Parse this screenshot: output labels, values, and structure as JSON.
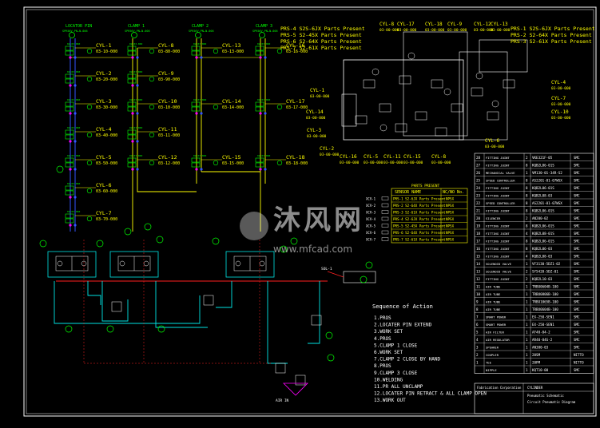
{
  "colors": {
    "background": "#000000",
    "frame": "#ffffff",
    "yellow": "#ffff00",
    "green": "#00ff00",
    "blue": "#3355ff",
    "cyan": "#00e5e5",
    "red": "#ff2020",
    "magenta": "#ff00ff"
  },
  "columns": [
    {
      "header": "LOCATOR PIN",
      "sub": "SPR56V-PN—N-006"
    },
    {
      "header": "CLAMP 1",
      "sub": "SPR56V-PN—N-006"
    },
    {
      "header": "CLAMP 2",
      "sub": "SPR56V-PN—N-006"
    },
    {
      "header": "CLAMP 3",
      "sub": "SPR56V-PN—N-006"
    }
  ],
  "left_cylinders": [
    {
      "name": "CYL-1",
      "code": "03-10-000"
    },
    {
      "name": "CYL-2",
      "code": "03-20-000"
    },
    {
      "name": "CYL-3",
      "code": "03-30-000"
    },
    {
      "name": "CYL-4",
      "code": "03-40-000"
    },
    {
      "name": "CYL-5",
      "code": "03-50-000"
    },
    {
      "name": "CYL-6",
      "code": "03-60-000"
    },
    {
      "name": "CYL-7",
      "code": "03-70-000"
    },
    {
      "name": "CYL-8",
      "code": "03-80-000"
    },
    {
      "name": "CYL-9",
      "code": "03-90-000"
    },
    {
      "name": "CYL-10",
      "code": "03-10-000"
    },
    {
      "name": "CYL-11",
      "code": "03-11-000"
    },
    {
      "name": "CYL-12",
      "code": "03-12-000"
    },
    {
      "name": "CYL-13",
      "code": "03-13-000"
    },
    {
      "name": "CYL-14",
      "code": "03-14-000"
    },
    {
      "name": "CYL-15",
      "code": "03-15-000"
    },
    {
      "name": "CYL-16",
      "code": "03-16-000"
    },
    {
      "name": "CYL-17",
      "code": "03-17-000"
    },
    {
      "name": "CYL-18",
      "code": "03-18-000"
    }
  ],
  "part_callouts": [
    "PRS-4  S2S-6JX Parts Present",
    "PRS-5  S2-45X Parts Present",
    "PRS-6  S2-64X Parts Present",
    "PRS-7  S2-61X Parts Present"
  ],
  "part_callouts_right": [
    "PRS-1  S2S-6JX Parts Present",
    "PRS-2  S2-64X Parts Present",
    "PRS-3  S2-61X Parts Present"
  ],
  "fixture_labels": [
    "CYL-17",
    "CYL-18",
    "CYL-9",
    "CYL-12",
    "CYL-13",
    "CYL-8",
    "CYL-1",
    "CYL-14",
    "CYL-3",
    "CYL-2",
    "CYL-16",
    "CYL-5",
    "CYL-11",
    "CYL-15",
    "CYL-8",
    "CYL-4",
    "CYL-7",
    "CYL-10",
    "CYL-6"
  ],
  "sensor_table": {
    "title": "PARTS PRESENT",
    "headers": [
      "SENSOR NAME",
      "NC/NO No."
    ],
    "rows": [
      [
        "PRS-1 S2-6JX Parts Present",
        "NPSX"
      ],
      [
        "PRS-2 S2-64X Parts Present",
        "NPSX"
      ],
      [
        "PRS-3 S2-61X Parts Present",
        "NPSX"
      ],
      [
        "PRS-4 S2-6JX Parts Present",
        "NPSX"
      ],
      [
        "PRS-5 S2-45X Parts Present",
        "NPSX"
      ],
      [
        "PRS-6 S2-64X Parts Present",
        "NPSX"
      ],
      [
        "PRS-7 S2-61X Parts Present",
        "NPSX"
      ]
    ],
    "side_labels": [
      "XCV-1",
      "XCV-2",
      "XCV-3",
      "XCV-4",
      "XCV-5",
      "XCV-6",
      "XCV-7"
    ]
  },
  "sequence": {
    "title": "Sequence of Action",
    "steps": [
      "1.PROS",
      "2.LOCATER PIN EXTEND",
      "3.WORK SET",
      "4.PROS",
      "5.CLAMP 1 CLOSE",
      "6.WORK SET",
      "7.CLAMP 2 CLOSE BY HAND",
      "8.PROS",
      "9.CLAMP 3 CLOSE",
      "10.WELDING",
      "11.PR ALL UNCLAMP",
      "12.LOCATER PIN RETRACT & ALL CLAMP OPEN",
      "13.WORK OUT"
    ]
  },
  "bom": [
    [
      "28",
      "FITTING JOINT",
      "2",
      "VKE321F-05",
      "SMC"
    ],
    [
      "27",
      "FITTING JOINT",
      "8",
      "KQB2L06-01S",
      "SMC"
    ],
    [
      "26",
      "MECHANICAL VALVE",
      "1",
      "VM130-01-34R-S2",
      "SMC"
    ],
    [
      "25",
      "SPEED CONTROLLER",
      "8",
      "AS2201-01-07WSX",
      "SMC"
    ],
    [
      "24",
      "FITTING JOINT",
      "8",
      "KQB2L06-01S",
      "SMC"
    ],
    [
      "23",
      "FITTING JOINT",
      "8",
      "KQB2L08-03",
      "SMC"
    ],
    [
      "22",
      "SPEED CONTROLLER",
      "8",
      "AS2201-01-07WSX",
      "SMC"
    ],
    [
      "21",
      "FITTING JOINT",
      "8",
      "KQB2L06-01S",
      "SMC"
    ],
    [
      "20",
      "SILENCER",
      "2",
      "AN200-02",
      "SMC"
    ],
    [
      "19",
      "FITTING JOINT",
      "8",
      "KQB2L06-01S",
      "SMC"
    ],
    [
      "18",
      "FITTING JOINT",
      "4",
      "KQB2L08-01S",
      "SMC"
    ],
    [
      "17",
      "FITTING JOINT",
      "8",
      "KQB2L06-01S",
      "SMC"
    ],
    [
      "16",
      "FITTING JOINT",
      "8",
      "KQB2L06-03",
      "SMC"
    ],
    [
      "15",
      "FITTING JOINT",
      "4",
      "KQB2L08-03",
      "SMC"
    ],
    [
      "14",
      "SOLENOID VALVE",
      "1",
      "VF3130-5DZ1-02",
      "SMC"
    ],
    [
      "13",
      "SOLENOID VALVE",
      "2",
      "SY5420-5DZ-01",
      "SMC"
    ],
    [
      "12",
      "FITTING JOINT",
      "2",
      "KQB2L10-03",
      "SMC"
    ],
    [
      "11",
      "AIR TUBE",
      "1",
      "TRBU0604B-100",
      "SMC"
    ],
    [
      "10",
      "AIR TUBE",
      "1",
      "TRBU0806B-100",
      "SMC"
    ],
    [
      "9",
      "AIR TUBE",
      "1",
      "TRBU1065B-100",
      "SMC"
    ],
    [
      "8",
      "AIR TUBE",
      "1",
      "TRBU0604B-100",
      "SMC"
    ],
    [
      "7",
      "SMART POWER",
      "1",
      "EX-250-SEN1",
      "SMC"
    ],
    [
      "6",
      "SMART POWER",
      "1",
      "EX-250-SEN1",
      "SMC"
    ],
    [
      "5",
      "AIR FILTER",
      "1",
      "AF40-04-2",
      "SMC"
    ],
    [
      "4",
      "AIR REGULATOR",
      "1",
      "AR40-04G-2",
      "SMC"
    ],
    [
      "3",
      "SPEAKER",
      "1",
      "AN300-03",
      "SMC"
    ],
    [
      "2",
      "COUPLER",
      "1",
      "20SM",
      "NITTO"
    ],
    [
      "1",
      "TEE",
      "1",
      "20PM",
      "NITTO"
    ],
    [
      "",
      "NIPPLE",
      "1",
      "KQT10-00",
      "SMC"
    ]
  ],
  "title_block": {
    "company": "Fabrication Corporation",
    "line1": "CYLINDER",
    "line2": "Pneumatic Schematic",
    "line3": "Circuit Pneumatic Diagram"
  },
  "watermark": {
    "brand": "沐风网",
    "url": "www.mfcad.com"
  },
  "notes": {
    "valve_tag": "SOL-1",
    "air_in": "AIR IN"
  }
}
